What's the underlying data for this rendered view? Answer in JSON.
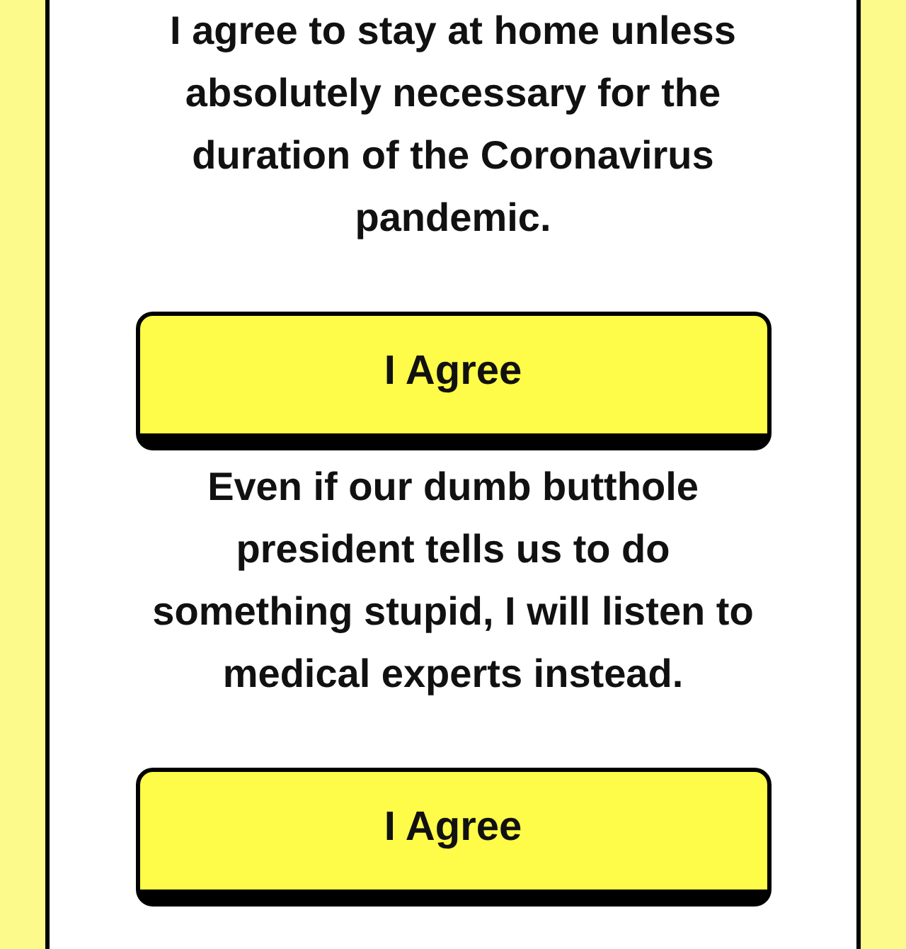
{
  "pledges": [
    {
      "text": "I agree to stay at home unless absolutely necessary for the duration of the Coronavirus pandemic.",
      "button": {
        "label": "I Agree"
      }
    },
    {
      "text": "Even if our dumb butthole president tells us to do something stupid, I will listen to medical experts instead.",
      "button": {
        "label": "I Agree"
      }
    }
  ]
}
